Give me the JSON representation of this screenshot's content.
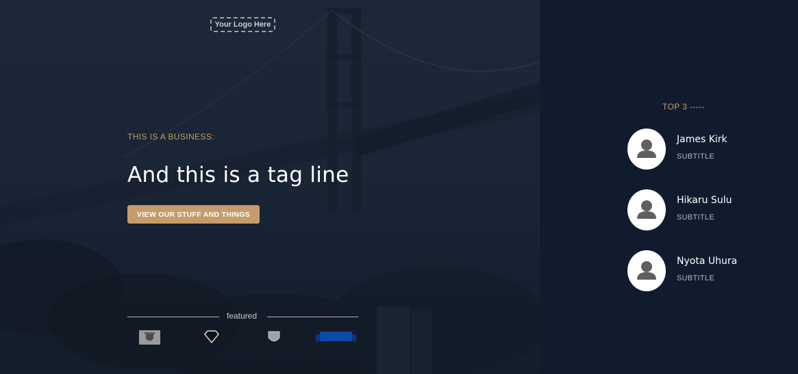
{
  "header": {
    "logo_text": "Your Logo Here"
  },
  "hero": {
    "eyebrow": "THIS IS A BUSINESS:",
    "tagline": "And this is a tag line",
    "cta_label": "VIEW OUR STUFF AND THINGS"
  },
  "featured": {
    "label": "featured",
    "badges": [
      "shield-crest-icon",
      "diamond-icon",
      "shield-icon",
      "ribbon-banner-icon"
    ]
  },
  "sidebar": {
    "title": "TOP 3 -----",
    "people": [
      {
        "name": "James Kirk",
        "subtitle": "SUBTITLE",
        "icon": "user-avatar-icon"
      },
      {
        "name": "Hikaru Sulu",
        "subtitle": "SUBTITLE",
        "icon": "user-avatar-icon"
      },
      {
        "name": "Nyota Uhura",
        "subtitle": "SUBTITLE",
        "icon": "user-avatar-icon"
      }
    ]
  },
  "colors": {
    "accent_gold": "#c69c6a",
    "hero_bg": "#1a2536",
    "sidebar_bg": "#101c2e",
    "badge_blue": "#0b4aa8"
  }
}
